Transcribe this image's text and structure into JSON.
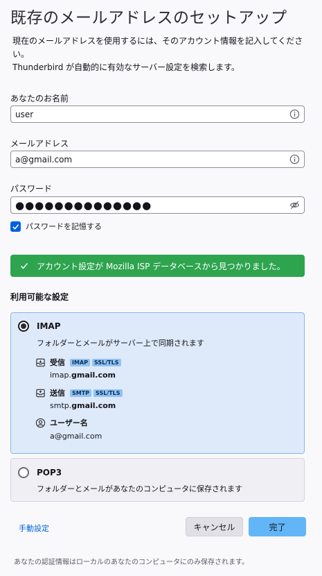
{
  "header": {
    "title": "既存のメールアドレスのセットアップ",
    "description_line1": "現在のメールアドレスを使用するには、そのアカウント情報を記入してください。",
    "description_line2": "Thunderbird が自動的に有効なサーバー設定を検索します。"
  },
  "form": {
    "name_label": "あなたのお名前",
    "name_value": "user",
    "email_label": "メールアドレス",
    "email_value": "a@gmail.com",
    "password_label": "パスワード",
    "password_mask": "●●●●●●●●●●●●●●",
    "remember_password_label": "パスワードを記憶する",
    "remember_password_checked": true
  },
  "status": {
    "success_message": "アカウント設定が Mozilla ISP データベースから見つかりました。",
    "color": "#2ea44f"
  },
  "configs": {
    "section_title": "利用可能な設定",
    "imap": {
      "name": "IMAP",
      "description": "フォルダーとメールがサーバー上で同期されます",
      "selected": true,
      "incoming_label": "受信",
      "incoming_badges": [
        "IMAP",
        "SSL/TLS"
      ],
      "incoming_host_prefix": "imap.",
      "incoming_host_domain": "gmail.com",
      "outgoing_label": "送信",
      "outgoing_badges": [
        "SMTP",
        "SSL/TLS"
      ],
      "outgoing_host_prefix": "smtp.",
      "outgoing_host_domain": "gmail.com",
      "username_label": "ユーザー名",
      "username_value": "a@gmail.com"
    },
    "pop3": {
      "name": "POP3",
      "description": "フォルダーとメールがあなたのコンピュータに保存されます",
      "selected": false
    }
  },
  "actions": {
    "manual_setup": "手動設定",
    "cancel": "キャンセル",
    "done": "完了",
    "accent": "#62b6f7"
  },
  "footer": {
    "note": "あなたの認証情報はローカルのあなたのコンピュータにのみ保存されます。"
  }
}
